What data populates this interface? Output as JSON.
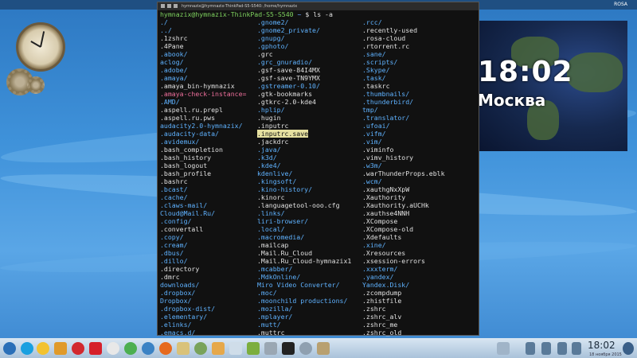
{
  "topbar": {
    "user": "ROSA"
  },
  "terminal": {
    "title": "hymnazix@hymnazix-ThinkPad-S5-S540: /home/hymnazix",
    "prompt_user": "hymnazix@hymnazix-ThinkPad-S5-S540",
    "prompt_path": "~",
    "prompt_cmd": " $ ls -a",
    "col1": [
      {
        "t": "./",
        "k": "dir"
      },
      {
        "t": "../",
        "k": "dir"
      },
      {
        "t": ".1zshrc",
        "k": "file"
      },
      {
        "t": ".4Pane",
        "k": "file"
      },
      {
        "t": ".abook/",
        "k": "dir"
      },
      {
        "t": "aclog/",
        "k": "dir"
      },
      {
        "t": ".adobe/",
        "k": "dir"
      },
      {
        "t": ".amaya/",
        "k": "dir"
      },
      {
        "t": ".amaya_bin-hymnazix",
        "k": "file"
      },
      {
        "t": ".amaya-check-instance=",
        "k": "link"
      },
      {
        "t": ".AMD/",
        "k": "dir"
      },
      {
        "t": ".aspell.ru.prepl",
        "k": "file"
      },
      {
        "t": ".aspell.ru.pws",
        "k": "file"
      },
      {
        "t": "audacity2.0-hymnazix/",
        "k": "dir"
      },
      {
        "t": ".audacity-data/",
        "k": "dir"
      },
      {
        "t": ".avidemux/",
        "k": "dir"
      },
      {
        "t": ".bash_completion",
        "k": "file"
      },
      {
        "t": ".bash_history",
        "k": "file"
      },
      {
        "t": ".bash_logout",
        "k": "file"
      },
      {
        "t": ".bash_profile",
        "k": "file"
      },
      {
        "t": ".bashrc",
        "k": "file"
      },
      {
        "t": ".bcast/",
        "k": "dir"
      },
      {
        "t": ".cache/",
        "k": "dir"
      },
      {
        "t": ".claws-mail/",
        "k": "dir"
      },
      {
        "t": "Cloud@Mail.Ru/",
        "k": "dir"
      },
      {
        "t": ".config/",
        "k": "dir"
      },
      {
        "t": ".convertall",
        "k": "file"
      },
      {
        "t": ".copy/",
        "k": "dir"
      },
      {
        "t": ".cream/",
        "k": "dir"
      },
      {
        "t": ".dbus/",
        "k": "dir"
      },
      {
        "t": ".dillo/",
        "k": "dir"
      },
      {
        "t": ".directory",
        "k": "file"
      },
      {
        "t": ".dmrc",
        "k": "file"
      },
      {
        "t": "downloads/",
        "k": "dir"
      },
      {
        "t": ".dropbox/",
        "k": "dir"
      },
      {
        "t": "Dropbox/",
        "k": "dir"
      },
      {
        "t": ".dropbox-dist/",
        "k": "dir"
      },
      {
        "t": ".elementary/",
        "k": "dir"
      },
      {
        "t": ".elinks/",
        "k": "dir"
      },
      {
        "t": ".emacs.d/",
        "k": "dir"
      }
    ],
    "col2": [
      {
        "t": ".gnome2/",
        "k": "dir"
      },
      {
        "t": ".gnome2_private/",
        "k": "dir"
      },
      {
        "t": ".gnupg/",
        "k": "dir"
      },
      {
        "t": ".gphoto/",
        "k": "dir"
      },
      {
        "t": ".grc",
        "k": "file"
      },
      {
        "t": ".grc_gnuradio/",
        "k": "dir"
      },
      {
        "t": ".gsf-save-84I4MX",
        "k": "file"
      },
      {
        "t": ".gsf-save-TN9YMX",
        "k": "file"
      },
      {
        "t": ".gstreamer-0.10/",
        "k": "dir"
      },
      {
        "t": ".gtk-bookmarks",
        "k": "file"
      },
      {
        "t": ".gtkrc-2.0-kde4",
        "k": "file"
      },
      {
        "t": ".hplip/",
        "k": "dir"
      },
      {
        "t": ".hugin",
        "k": "file"
      },
      {
        "t": ".inputrc",
        "k": "file"
      },
      {
        "t": ".inputrc.save",
        "k": "hl"
      },
      {
        "t": ".jackdrc",
        "k": "file"
      },
      {
        "t": ".java/",
        "k": "dir"
      },
      {
        "t": ".k3d/",
        "k": "dir"
      },
      {
        "t": ".kde4/",
        "k": "dir"
      },
      {
        "t": "kdenlive/",
        "k": "dir"
      },
      {
        "t": ".kingsoft/",
        "k": "dir"
      },
      {
        "t": ".kino-history/",
        "k": "dir"
      },
      {
        "t": ".kinorc",
        "k": "file"
      },
      {
        "t": ".languagetool-ooo.cfg",
        "k": "file"
      },
      {
        "t": ".links/",
        "k": "dir"
      },
      {
        "t": "liri-browser/",
        "k": "dir"
      },
      {
        "t": ".local/",
        "k": "dir"
      },
      {
        "t": ".macromedia/",
        "k": "dir"
      },
      {
        "t": ".mailcap",
        "k": "file"
      },
      {
        "t": ".Mail.Ru_Cloud",
        "k": "file"
      },
      {
        "t": ".Mail.Ru_Cloud-hymnazix1",
        "k": "file"
      },
      {
        "t": ".mcabber/",
        "k": "dir"
      },
      {
        "t": ".MdkOnline/",
        "k": "dir"
      },
      {
        "t": "Miro Video Converter/",
        "k": "dir"
      },
      {
        "t": ".moc/",
        "k": "dir"
      },
      {
        "t": ".moonchild productions/",
        "k": "dir"
      },
      {
        "t": ".mozilla/",
        "k": "dir"
      },
      {
        "t": ".mplayer/",
        "k": "dir"
      },
      {
        "t": ".mutt/",
        "k": "dir"
      },
      {
        "t": ".muttrc",
        "k": "file"
      }
    ],
    "col3": [
      {
        "t": ".rcc/",
        "k": "dir"
      },
      {
        "t": ".recently-used",
        "k": "file"
      },
      {
        "t": ".rosa-cloud",
        "k": "file"
      },
      {
        "t": ".rtorrent.rc",
        "k": "file"
      },
      {
        "t": ".sane/",
        "k": "dir"
      },
      {
        "t": ".scripts/",
        "k": "dir"
      },
      {
        "t": ".Skype/",
        "k": "dir"
      },
      {
        "t": ".task/",
        "k": "dir"
      },
      {
        "t": ".taskrc",
        "k": "file"
      },
      {
        "t": ".thumbnails/",
        "k": "dir"
      },
      {
        "t": ".thunderbird/",
        "k": "dir"
      },
      {
        "t": "tmp/",
        "k": "dir"
      },
      {
        "t": ".translator/",
        "k": "dir"
      },
      {
        "t": ".ufoai/",
        "k": "dir"
      },
      {
        "t": ".vifm/",
        "k": "dir"
      },
      {
        "t": ".vim/",
        "k": "dir"
      },
      {
        "t": ".viminfo",
        "k": "file"
      },
      {
        "t": ".vimv_history",
        "k": "file"
      },
      {
        "t": ".w3m/",
        "k": "dir"
      },
      {
        "t": ".warThunderProps.eblk",
        "k": "file"
      },
      {
        "t": ".wcm/",
        "k": "dir"
      },
      {
        "t": ".xauthgNxXpW",
        "k": "file"
      },
      {
        "t": ".Xauthority",
        "k": "file"
      },
      {
        "t": ".Xauthority.aUCHk",
        "k": "file"
      },
      {
        "t": ".xauthse4NNH",
        "k": "file"
      },
      {
        "t": ".XCompose",
        "k": "file"
      },
      {
        "t": ".XCompose-old",
        "k": "file"
      },
      {
        "t": ".Xdefaults",
        "k": "file"
      },
      {
        "t": ".xine/",
        "k": "dir"
      },
      {
        "t": ".Xresources",
        "k": "file"
      },
      {
        "t": ".xsession-errors",
        "k": "file"
      },
      {
        "t": ".xxxterm/",
        "k": "dir"
      },
      {
        "t": ".yandex/",
        "k": "dir"
      },
      {
        "t": "Yandex.Disk/",
        "k": "dir"
      },
      {
        "t": ".zcompdump",
        "k": "file"
      },
      {
        "t": ".zhistfile",
        "k": "file"
      },
      {
        "t": ".zshrc",
        "k": "file"
      },
      {
        "t": ".zshrc_alv",
        "k": "file"
      },
      {
        "t": ".zshrc_me",
        "k": "file"
      },
      {
        "t": ".zshrc_old",
        "k": "file"
      }
    ]
  },
  "widget": {
    "time": "18:02",
    "city": "Москва"
  },
  "taskbar": {
    "time": "18:02",
    "date": "18 ноября 2015"
  },
  "colors": {
    "dir": "#5fb2ff",
    "prompt_user": "#7fd35f",
    "highlight": "#e6e0a0",
    "broken_link": "#ee6f9b"
  }
}
